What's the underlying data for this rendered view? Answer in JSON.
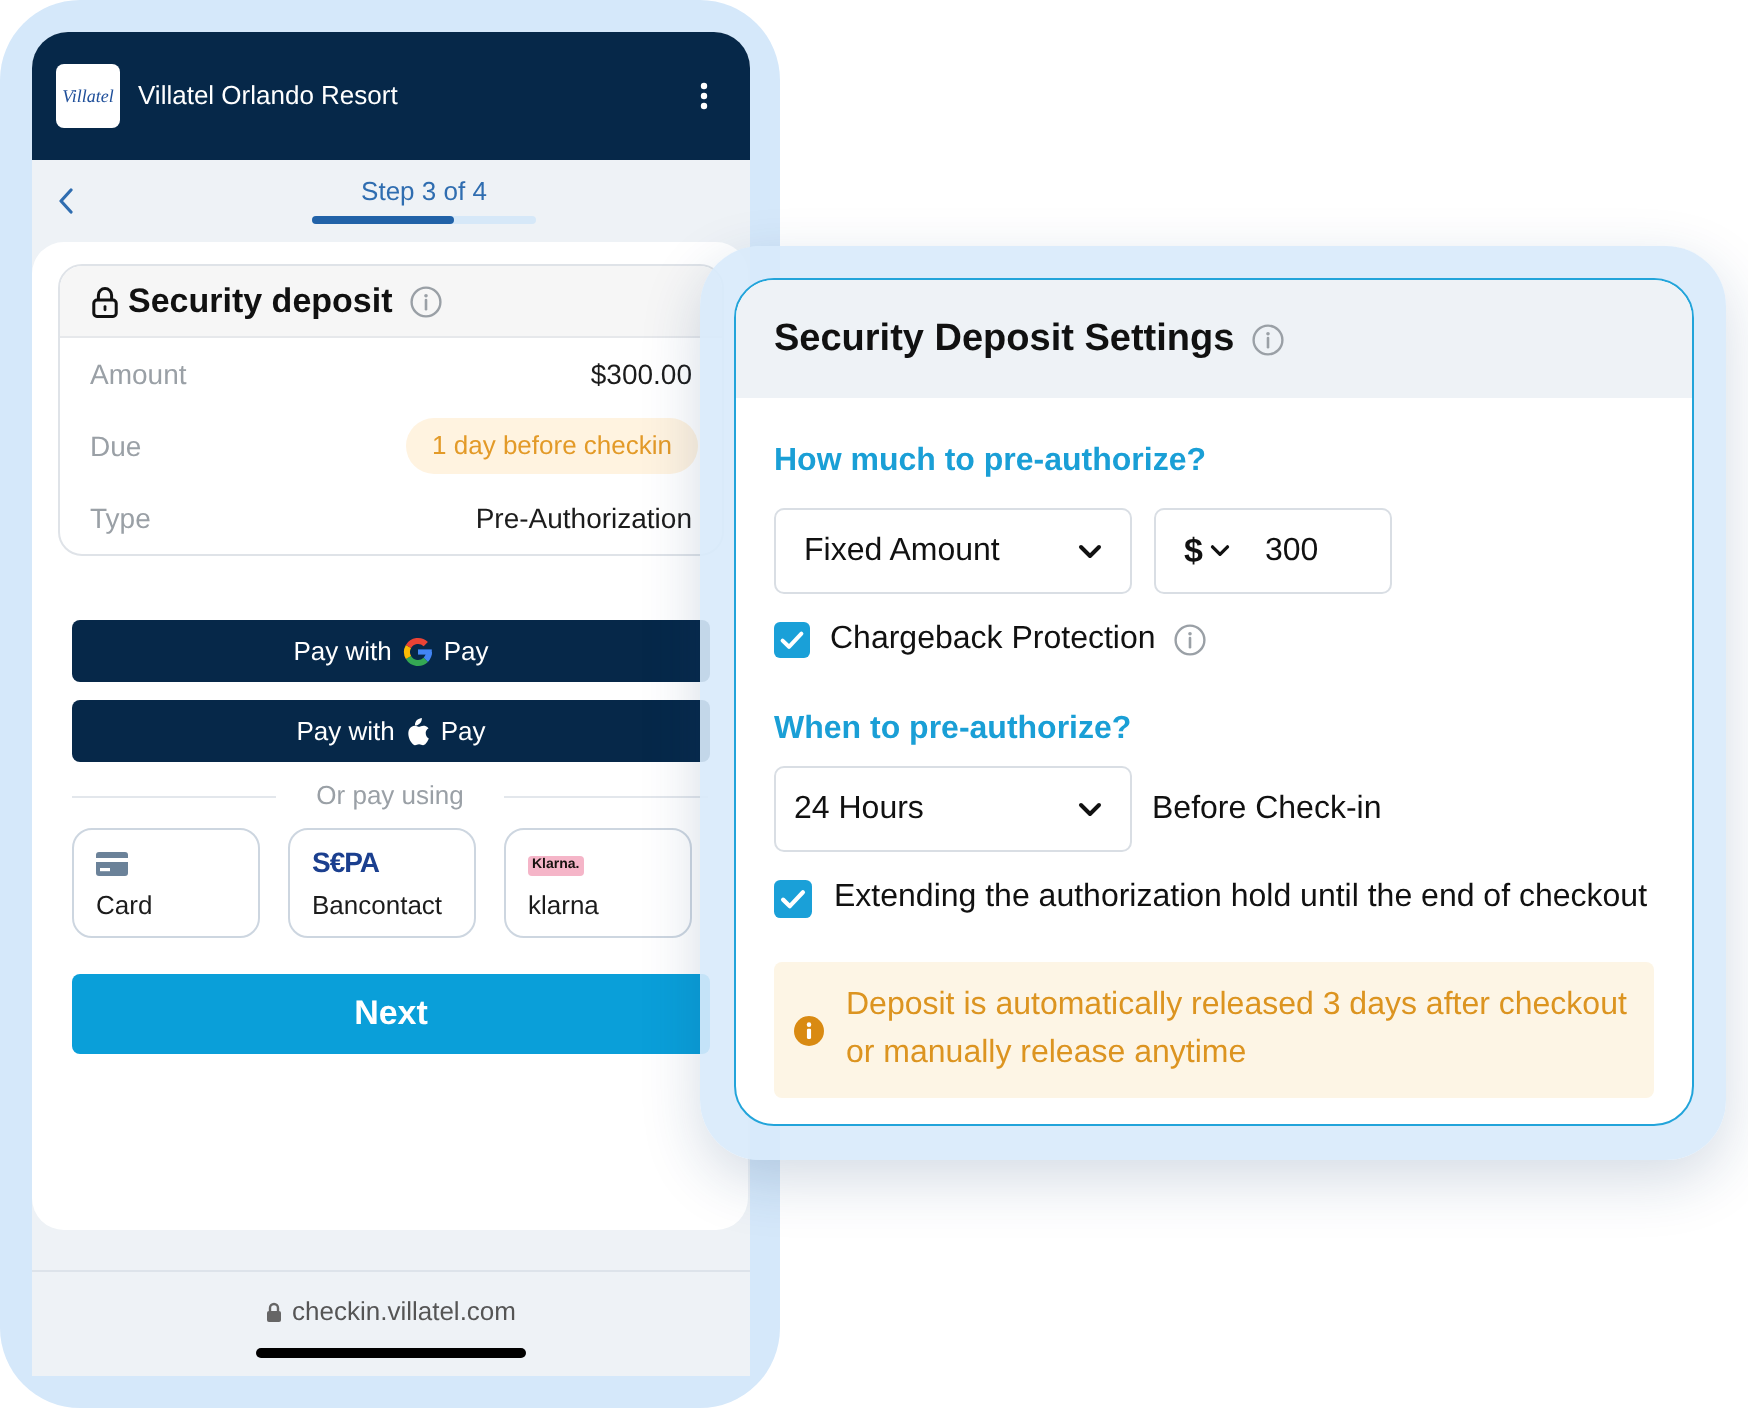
{
  "phone": {
    "header": {
      "logo_text": "Villatel",
      "title": "Villatel Orlando Resort"
    },
    "step": {
      "label": "Step 3 of 4",
      "level": 0.63
    },
    "deposit_card": {
      "title": "Security deposit",
      "rows": [
        {
          "kind": "text",
          "label": "Amount",
          "value": "$300.00"
        },
        {
          "kind": "badge",
          "label": "Due",
          "value": "1 day before checkin"
        },
        {
          "kind": "text",
          "label": "Type",
          "value": "Pre-Authorization"
        }
      ]
    },
    "wallet_buttons": [
      {
        "kind": "google",
        "text_before": "Pay with",
        "text_after": "Pay"
      },
      {
        "kind": "apple",
        "text_before": "Pay with",
        "text_after": "Pay"
      }
    ],
    "divider_label": "Or pay using",
    "payment_methods": [
      {
        "kind": "card",
        "label": "Card"
      },
      {
        "kind": "sepa",
        "logo": "S€PA",
        "label": "Bancontact"
      },
      {
        "kind": "klarna",
        "logo": "Klarna.",
        "label": "klarna"
      }
    ],
    "next_button": "Next",
    "address_bar": {
      "url": "checkin.villatel.com"
    }
  },
  "settings": {
    "title": "Security Deposit Settings",
    "amount_section": {
      "heading": "How much to pre-authorize?",
      "type_select": "Fixed Amount",
      "currency": "$",
      "amount": "300",
      "chargeback": {
        "label": "Chargeback Protection",
        "checked": true
      }
    },
    "timing_section": {
      "heading": "When to pre-authorize?",
      "offset_select": "24 Hours",
      "suffix": "Before Check-in",
      "extend_hold": {
        "label": "Extending the authorization hold until the end of checkout",
        "checked": true
      }
    },
    "notice": "Deposit is automatically released 3 days after checkout or manually release anytime"
  }
}
